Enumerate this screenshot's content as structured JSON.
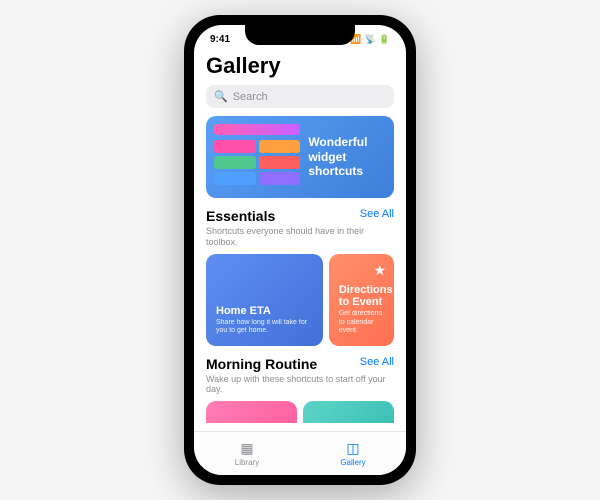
{
  "status": {
    "time": "9:41",
    "signal": "●●●●",
    "wifi": "⬤",
    "battery": "■"
  },
  "page_title": "Gallery",
  "search": {
    "placeholder": "Search"
  },
  "featured": {
    "title": "Wonderful widget shortcuts"
  },
  "sections": [
    {
      "title": "Essentials",
      "see_all": "See All",
      "subtitle": "Shortcuts everyone should have in their toolbox.",
      "cards": [
        {
          "title": "Home ETA",
          "desc": "Share how long it will take for you to get home."
        },
        {
          "title": "Directions to Event",
          "desc": "Get directions to calendar event."
        }
      ]
    },
    {
      "title": "Morning Routine",
      "see_all": "See All",
      "subtitle": "Wake up with these shortcuts to start off your day."
    }
  ],
  "tabs": [
    {
      "label": "Library"
    },
    {
      "label": "Gallery"
    }
  ]
}
